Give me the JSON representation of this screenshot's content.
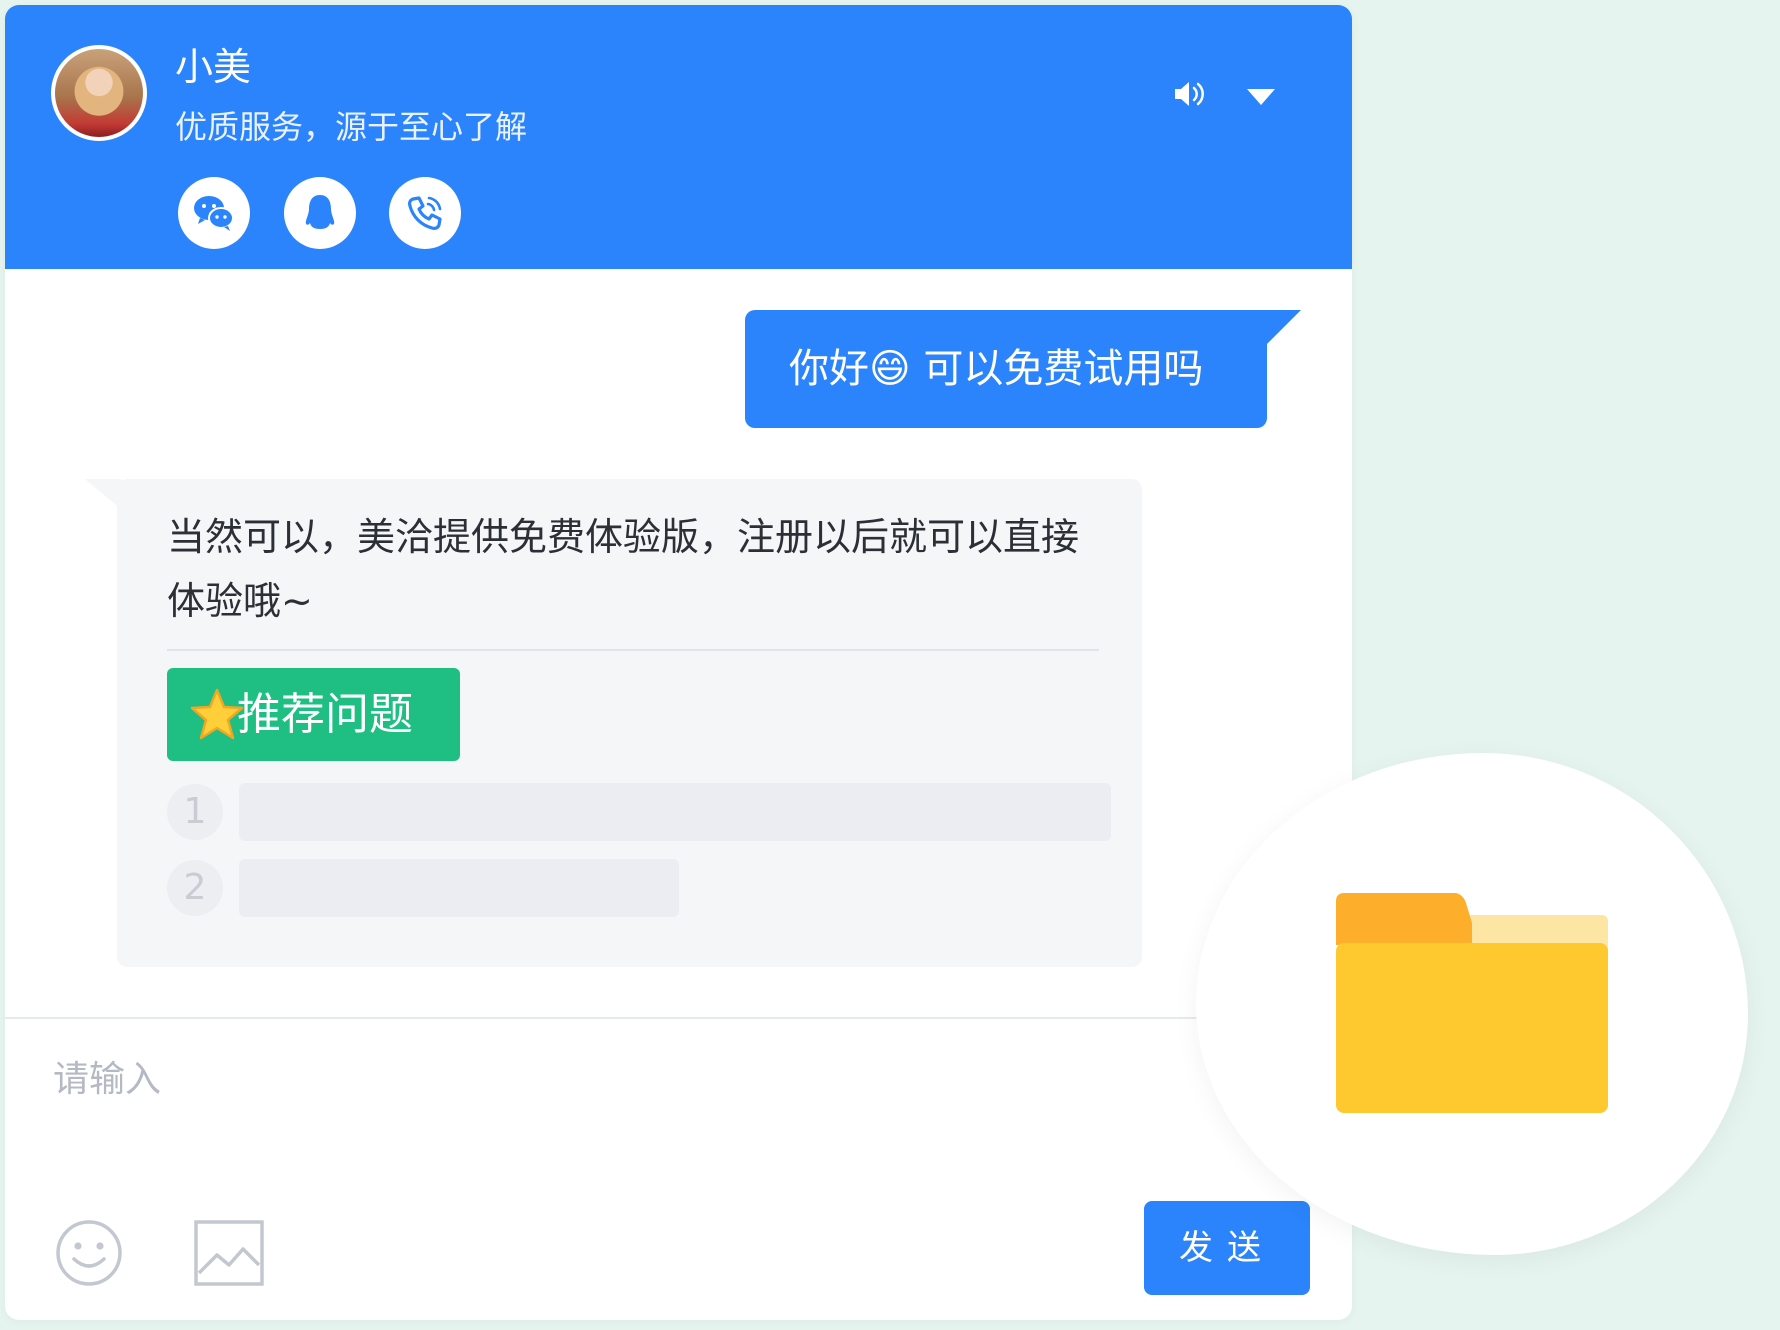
{
  "header": {
    "agent_name": "小美",
    "agent_slogan": "优质服务，源于至心了解",
    "contacts": [
      "wechat-icon",
      "qq-icon",
      "phone-icon"
    ],
    "controls": [
      "sound-icon",
      "chevron-down-icon"
    ],
    "background": "#2b84fb"
  },
  "messages": {
    "outgoing": {
      "text_before": "你好",
      "emoji": "😄",
      "text_after": " 可以免费试用吗"
    },
    "incoming": {
      "text": "当然可以，美洽提供免费体验版，注册以后就可以直接体验哦~",
      "recommend_label": "推荐问题",
      "recommend_icon": "star-icon",
      "recommend_color": "#1fbf83",
      "questions": [
        {
          "number": "1"
        },
        {
          "number": "2"
        }
      ]
    }
  },
  "composer": {
    "placeholder": "请输入",
    "send_label": "发送",
    "tools": [
      "emoji-icon",
      "image-icon"
    ]
  },
  "overlay": {
    "icon": "folder-icon",
    "folder_color": "#fdc92e"
  }
}
